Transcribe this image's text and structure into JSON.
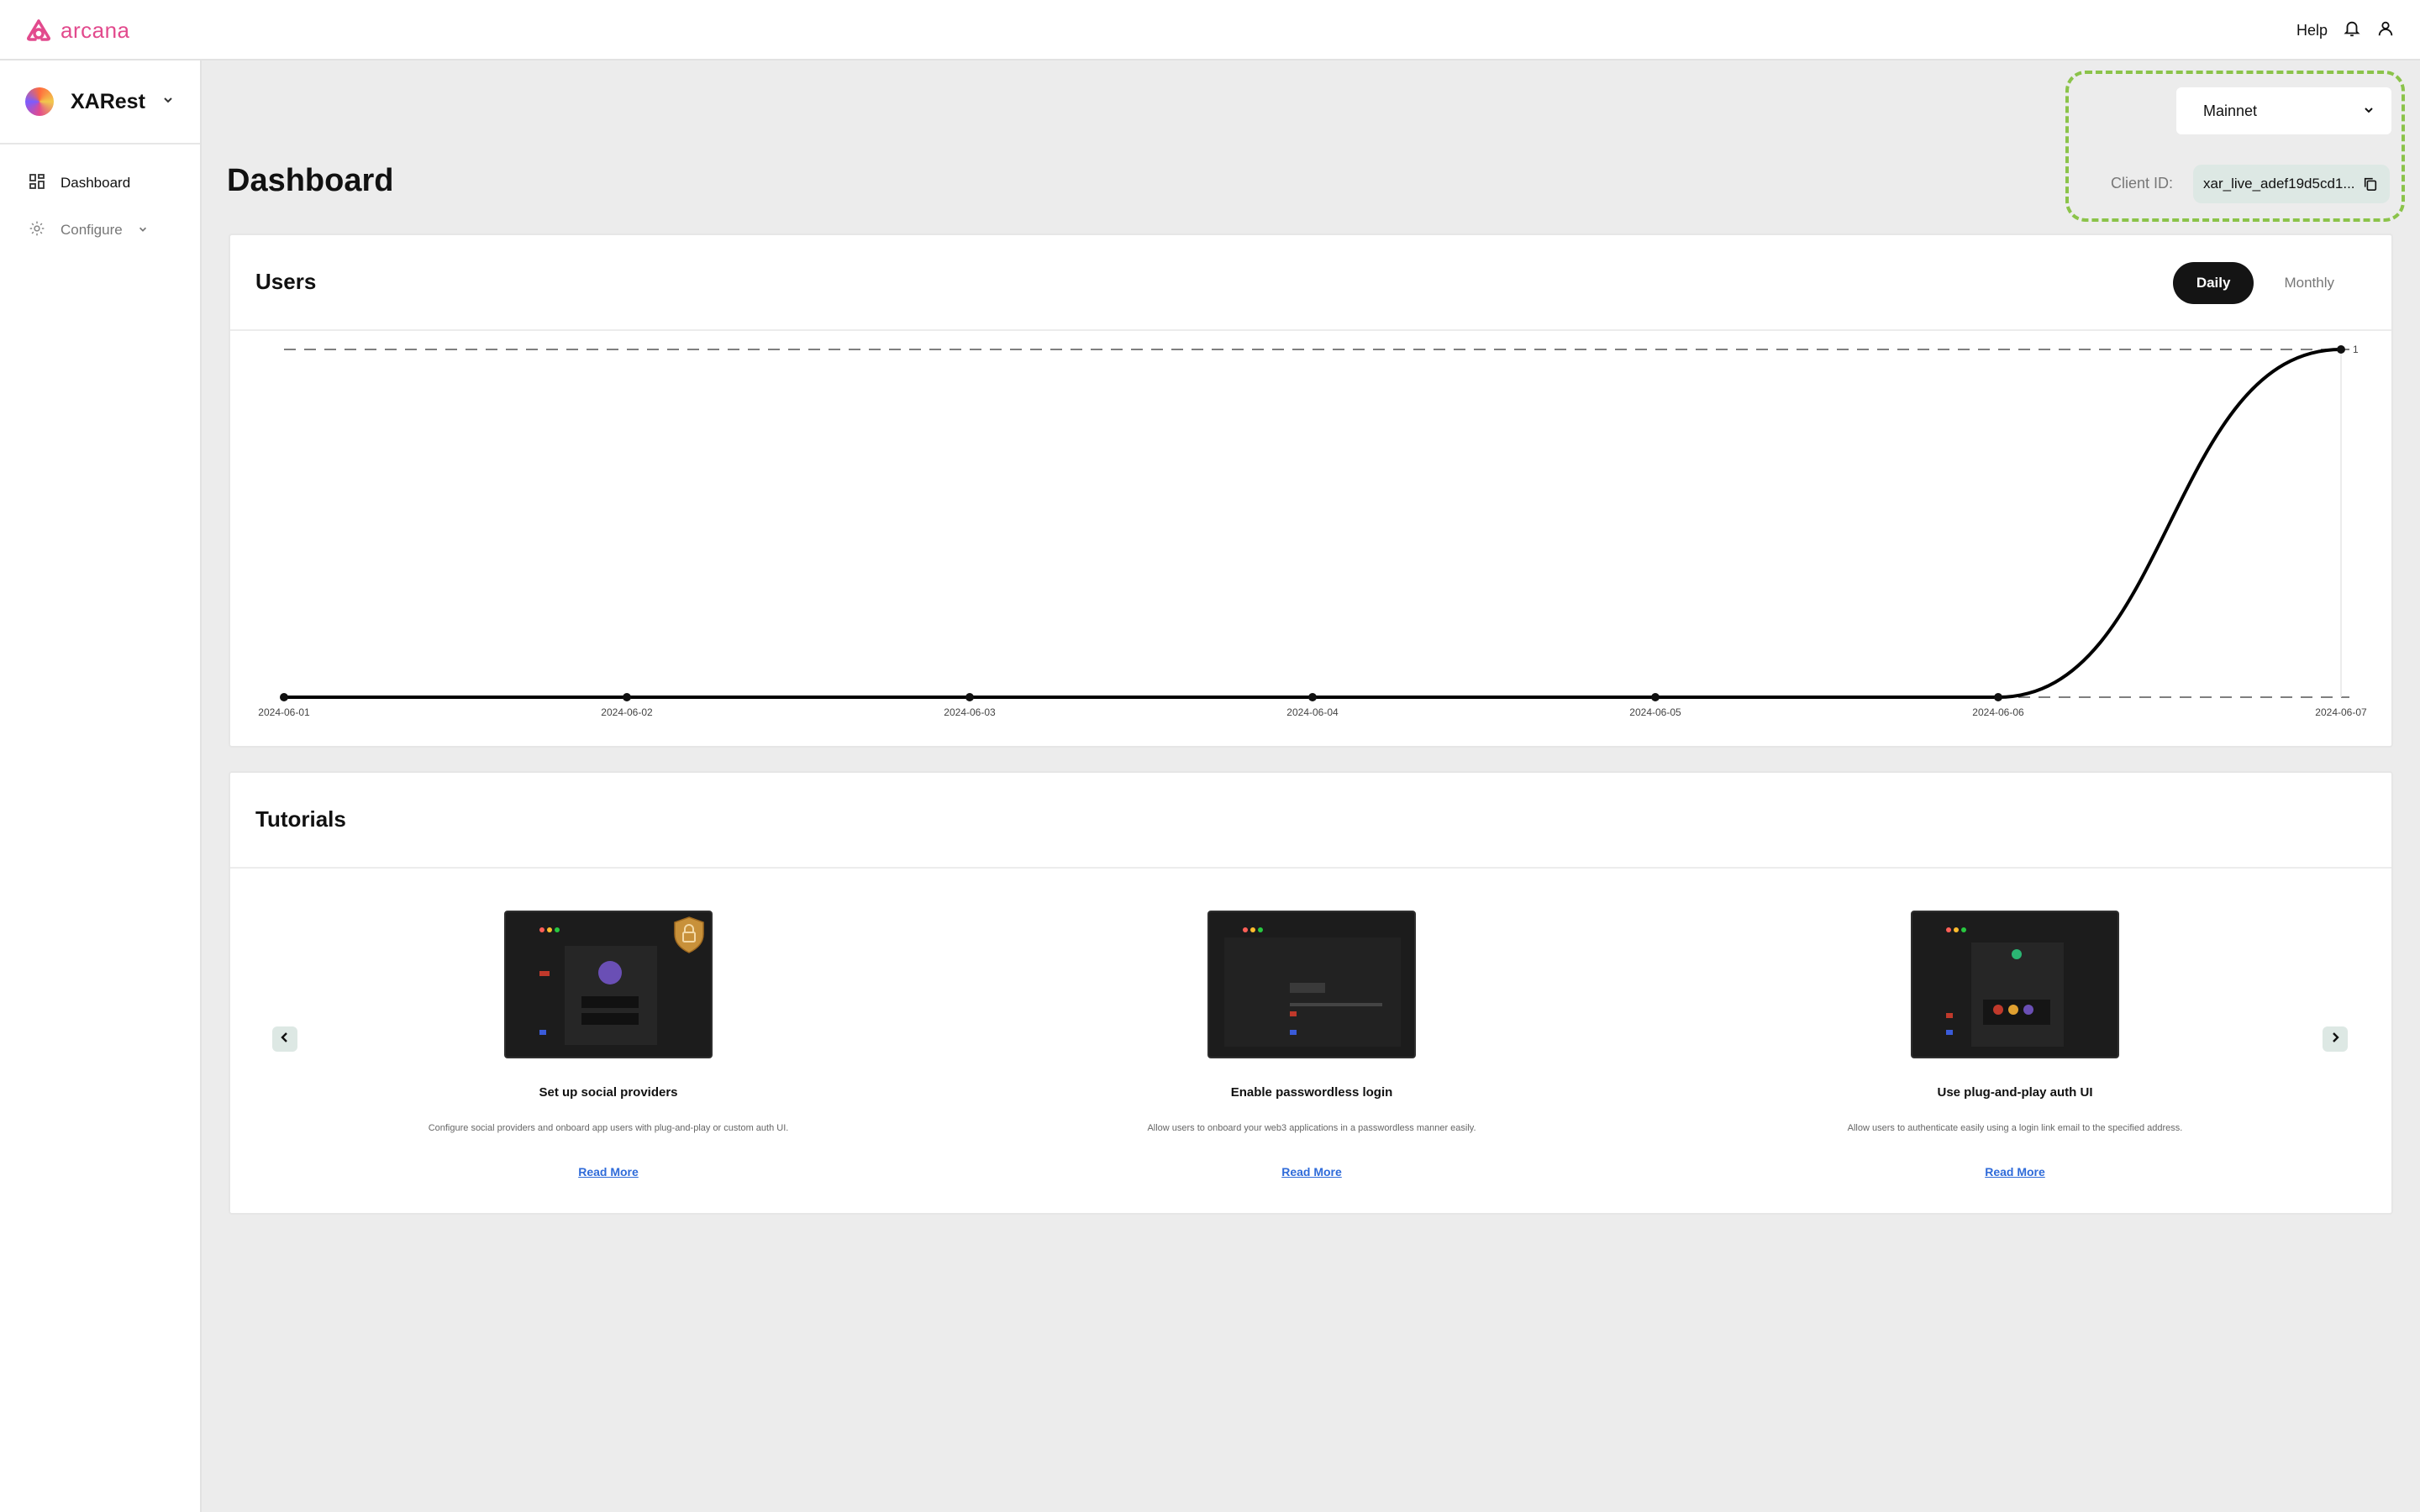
{
  "topbar": {
    "logo_text": "arcana",
    "help": "Help"
  },
  "sidebar": {
    "app_name": "XARest",
    "items": [
      {
        "label": "Dashboard",
        "icon": "grid-icon"
      },
      {
        "label": "Configure",
        "icon": "gear-icon"
      }
    ]
  },
  "main": {
    "title": "Dashboard",
    "network": {
      "selected": "Mainnet"
    },
    "client_id": {
      "label": "Client ID:",
      "value": "xar_live_adef19d5cd1..."
    }
  },
  "users_card": {
    "title": "Users",
    "toggle": {
      "daily": "Daily",
      "monthly": "Monthly",
      "active": "Daily"
    }
  },
  "chart_data": {
    "type": "line",
    "title": "Users",
    "x": [
      "2024-06-01",
      "2024-06-02",
      "2024-06-03",
      "2024-06-04",
      "2024-06-05",
      "2024-06-06",
      "2024-06-07"
    ],
    "series": [
      {
        "values": [
          0,
          0,
          0,
          0,
          0,
          0,
          1
        ]
      }
    ],
    "point_labels": [
      "",
      "",
      "",
      "",
      "",
      "",
      "1"
    ],
    "ylim": [
      0,
      1
    ],
    "grid": "dashed horizontal lines at 0 and 1",
    "line_color": "#000000"
  },
  "tutorials": {
    "title": "Tutorials",
    "items": [
      {
        "title": "Set up social providers",
        "description": "Configure social providers and onboard app users with plug-and-play or custom auth UI.",
        "link": "Read More"
      },
      {
        "title": "Enable passwordless login",
        "description": "Allow users to onboard your web3 applications in a passwordless manner easily.",
        "link": "Read More"
      },
      {
        "title": "Use plug-and-play auth UI",
        "description": "Allow users to authenticate easily using a login link email to the specified address.",
        "link": "Read More"
      }
    ]
  },
  "colors": {
    "brand": "#e24a8d",
    "accent_border": "#8bc34a",
    "link": "#2f6bd9",
    "active_toggle": "#141414"
  }
}
